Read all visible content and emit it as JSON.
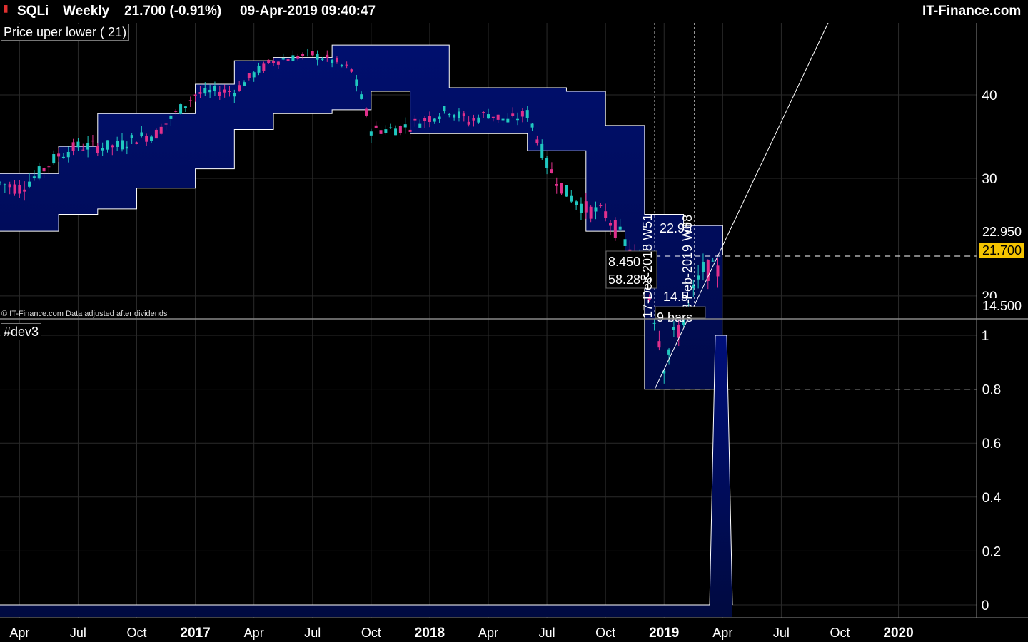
{
  "header": {
    "symbol": "SQLi",
    "period": "Weekly",
    "price_change": "21.700 (-0.91%)",
    "datetime": "09-Apr-2019 09:40:47",
    "brand": "IT-Finance.com"
  },
  "price_panel": {
    "indicator_label": "Price uper lower ( 21)",
    "copyright": "© IT-Finance.com Data adjusted after dividends",
    "tags": {
      "high": "22.950",
      "last": "21.700",
      "low": "14.500"
    },
    "last_tag_color": "#f5c400",
    "annotations": {
      "box_change": "8.450",
      "box_pct": "58.28%",
      "hi_value": "22.95",
      "lo_value": "14.5",
      "marker1": "17-Dec-2018 W51",
      "marker2": "18-Feb-2019 W08",
      "bars": "9 bars"
    }
  },
  "dev_panel": {
    "label": "#dev3"
  },
  "colors": {
    "band_fill": "#000f6e",
    "up_candle": "#20c8c0",
    "down_candle": "#e0308c",
    "grid": "#2a2a2a"
  },
  "chart_data": [
    {
      "type": "candlestick",
      "title": "SQLi Weekly",
      "y_axis_ticks": [
        20,
        30,
        40
      ],
      "x_axis_ticks": [
        "Apr",
        "Jul",
        "Oct",
        "2017",
        "Apr",
        "Jul",
        "Oct",
        "2018",
        "Apr",
        "Jul",
        "Oct",
        "2019",
        "Apr",
        "Jul",
        "Oct",
        "2020"
      ],
      "series": [
        {
          "name": "Price",
          "x": [
            "2016-03",
            "2016-04",
            "2016-05",
            "2016-06",
            "2016-07",
            "2016-08",
            "2016-09",
            "2016-10",
            "2016-11",
            "2016-12",
            "2017-01",
            "2017-02",
            "2017-03",
            "2017-04",
            "2017-05",
            "2017-06",
            "2017-07",
            "2017-08",
            "2017-09",
            "2017-10",
            "2017-11",
            "2017-12",
            "2018-01",
            "2018-02",
            "2018-03",
            "2018-04",
            "2018-05",
            "2018-06",
            "2018-07",
            "2018-08",
            "2018-09",
            "2018-10",
            "2018-11",
            "2018-12",
            "2019-01",
            "2019-02",
            "2019-03",
            "2019-04"
          ],
          "y": [
            29.5,
            29.0,
            30.5,
            32.5,
            33.5,
            33.5,
            33.5,
            34.5,
            35.0,
            37.5,
            40.0,
            40.5,
            40.5,
            43.0,
            45.0,
            45.5,
            46.0,
            45.0,
            43.5,
            35.5,
            35.5,
            36.0,
            37.0,
            38.0,
            36.5,
            37.5,
            36.5,
            37.5,
            31.5,
            28.5,
            27.0,
            26.5,
            24.0,
            21.5,
            16.0,
            18.5,
            21.9,
            21.7
          ]
        },
        {
          "name": "uper",
          "x": [
            "2016-03",
            "2016-06",
            "2016-08",
            "2016-10",
            "2017-01",
            "2017-03",
            "2017-05",
            "2017-08",
            "2017-11",
            "2018-02",
            "2018-05",
            "2018-08",
            "2018-10",
            "2018-12",
            "2019-02",
            "2019-04"
          ],
          "y": [
            30.5,
            33.5,
            37.5,
            37.5,
            41.5,
            45.0,
            45.5,
            47.5,
            47.5,
            41.0,
            41.0,
            40.5,
            36.0,
            26.5,
            25.5,
            23.0
          ]
        },
        {
          "name": "lower",
          "x": [
            "2016-03",
            "2016-06",
            "2016-08",
            "2016-10",
            "2017-01",
            "2017-03",
            "2017-05",
            "2017-08",
            "2017-10",
            "2017-12",
            "2018-03",
            "2018-06",
            "2018-09",
            "2018-11",
            "2018-12",
            "2019-04"
          ],
          "y": [
            25.0,
            26.5,
            27.0,
            29.0,
            31.0,
            35.5,
            37.5,
            38.0,
            40.5,
            35.0,
            35.0,
            33.0,
            25.0,
            21.0,
            14.5,
            14.5
          ]
        }
      ],
      "levels": [
        22.95,
        21.7,
        14.5
      ]
    },
    {
      "type": "area",
      "title": "#dev3",
      "y_axis_ticks": [
        0,
        0.2,
        0.4,
        0.6,
        0.8,
        1
      ],
      "ylim": [
        0,
        1
      ],
      "series": [
        {
          "name": "#dev3",
          "x": [
            "2016-03",
            "2019-02",
            "2019-02",
            "2019-03",
            "2019-04"
          ],
          "y": [
            0,
            0,
            1,
            1,
            0
          ]
        }
      ]
    }
  ]
}
